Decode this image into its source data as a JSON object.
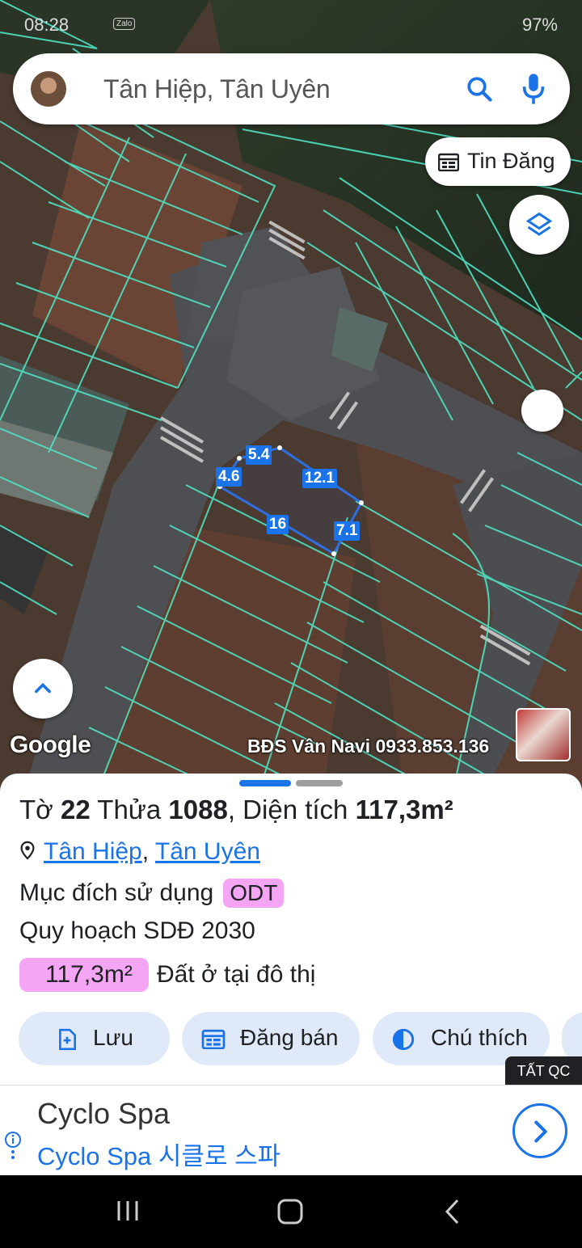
{
  "status_bar": {
    "time": "08:28",
    "app_badge": "Zalo",
    "battery": "97%"
  },
  "search": {
    "query": "Tân Hiệp, Tân Uyên"
  },
  "buttons": {
    "tin_dang": "Tin Đăng"
  },
  "map": {
    "edge_lengths": [
      "5.4",
      "4.6",
      "12.1",
      "16",
      "7.1"
    ],
    "google_logo": "Google",
    "watermark": "BĐS Vân Navi 0933.853.136"
  },
  "sheet": {
    "title_prefix": "Tờ",
    "sheet_no": "22",
    "plot_prefix": "Thửa",
    "plot_no": "1088",
    "area_prefix": ", Diện tích",
    "area": "117,3m²",
    "location": {
      "commune": "Tân Hiệp",
      "district": "Tân Uyên"
    },
    "purpose_label": "Mục đích sử dụng",
    "purpose_code": "ODT",
    "plan_label": "Quy hoạch SDĐ 2030",
    "plan_area": "117,3m²",
    "plan_use": "Đất ở tại đô thị",
    "actions": [
      {
        "label": "Lưu"
      },
      {
        "label": "Đăng bán"
      },
      {
        "label": "Chú thích"
      }
    ]
  },
  "ad": {
    "badge": "TẤT QC",
    "name": "Cyclo Spa",
    "subtitle": "Cyclo Spa 시클로 스파"
  },
  "colors": {
    "accent": "#1a73e8",
    "tag_pink": "#f4a6f4",
    "parcel_line": "#4fe3c2",
    "chip_bg": "#dfe9f8"
  }
}
